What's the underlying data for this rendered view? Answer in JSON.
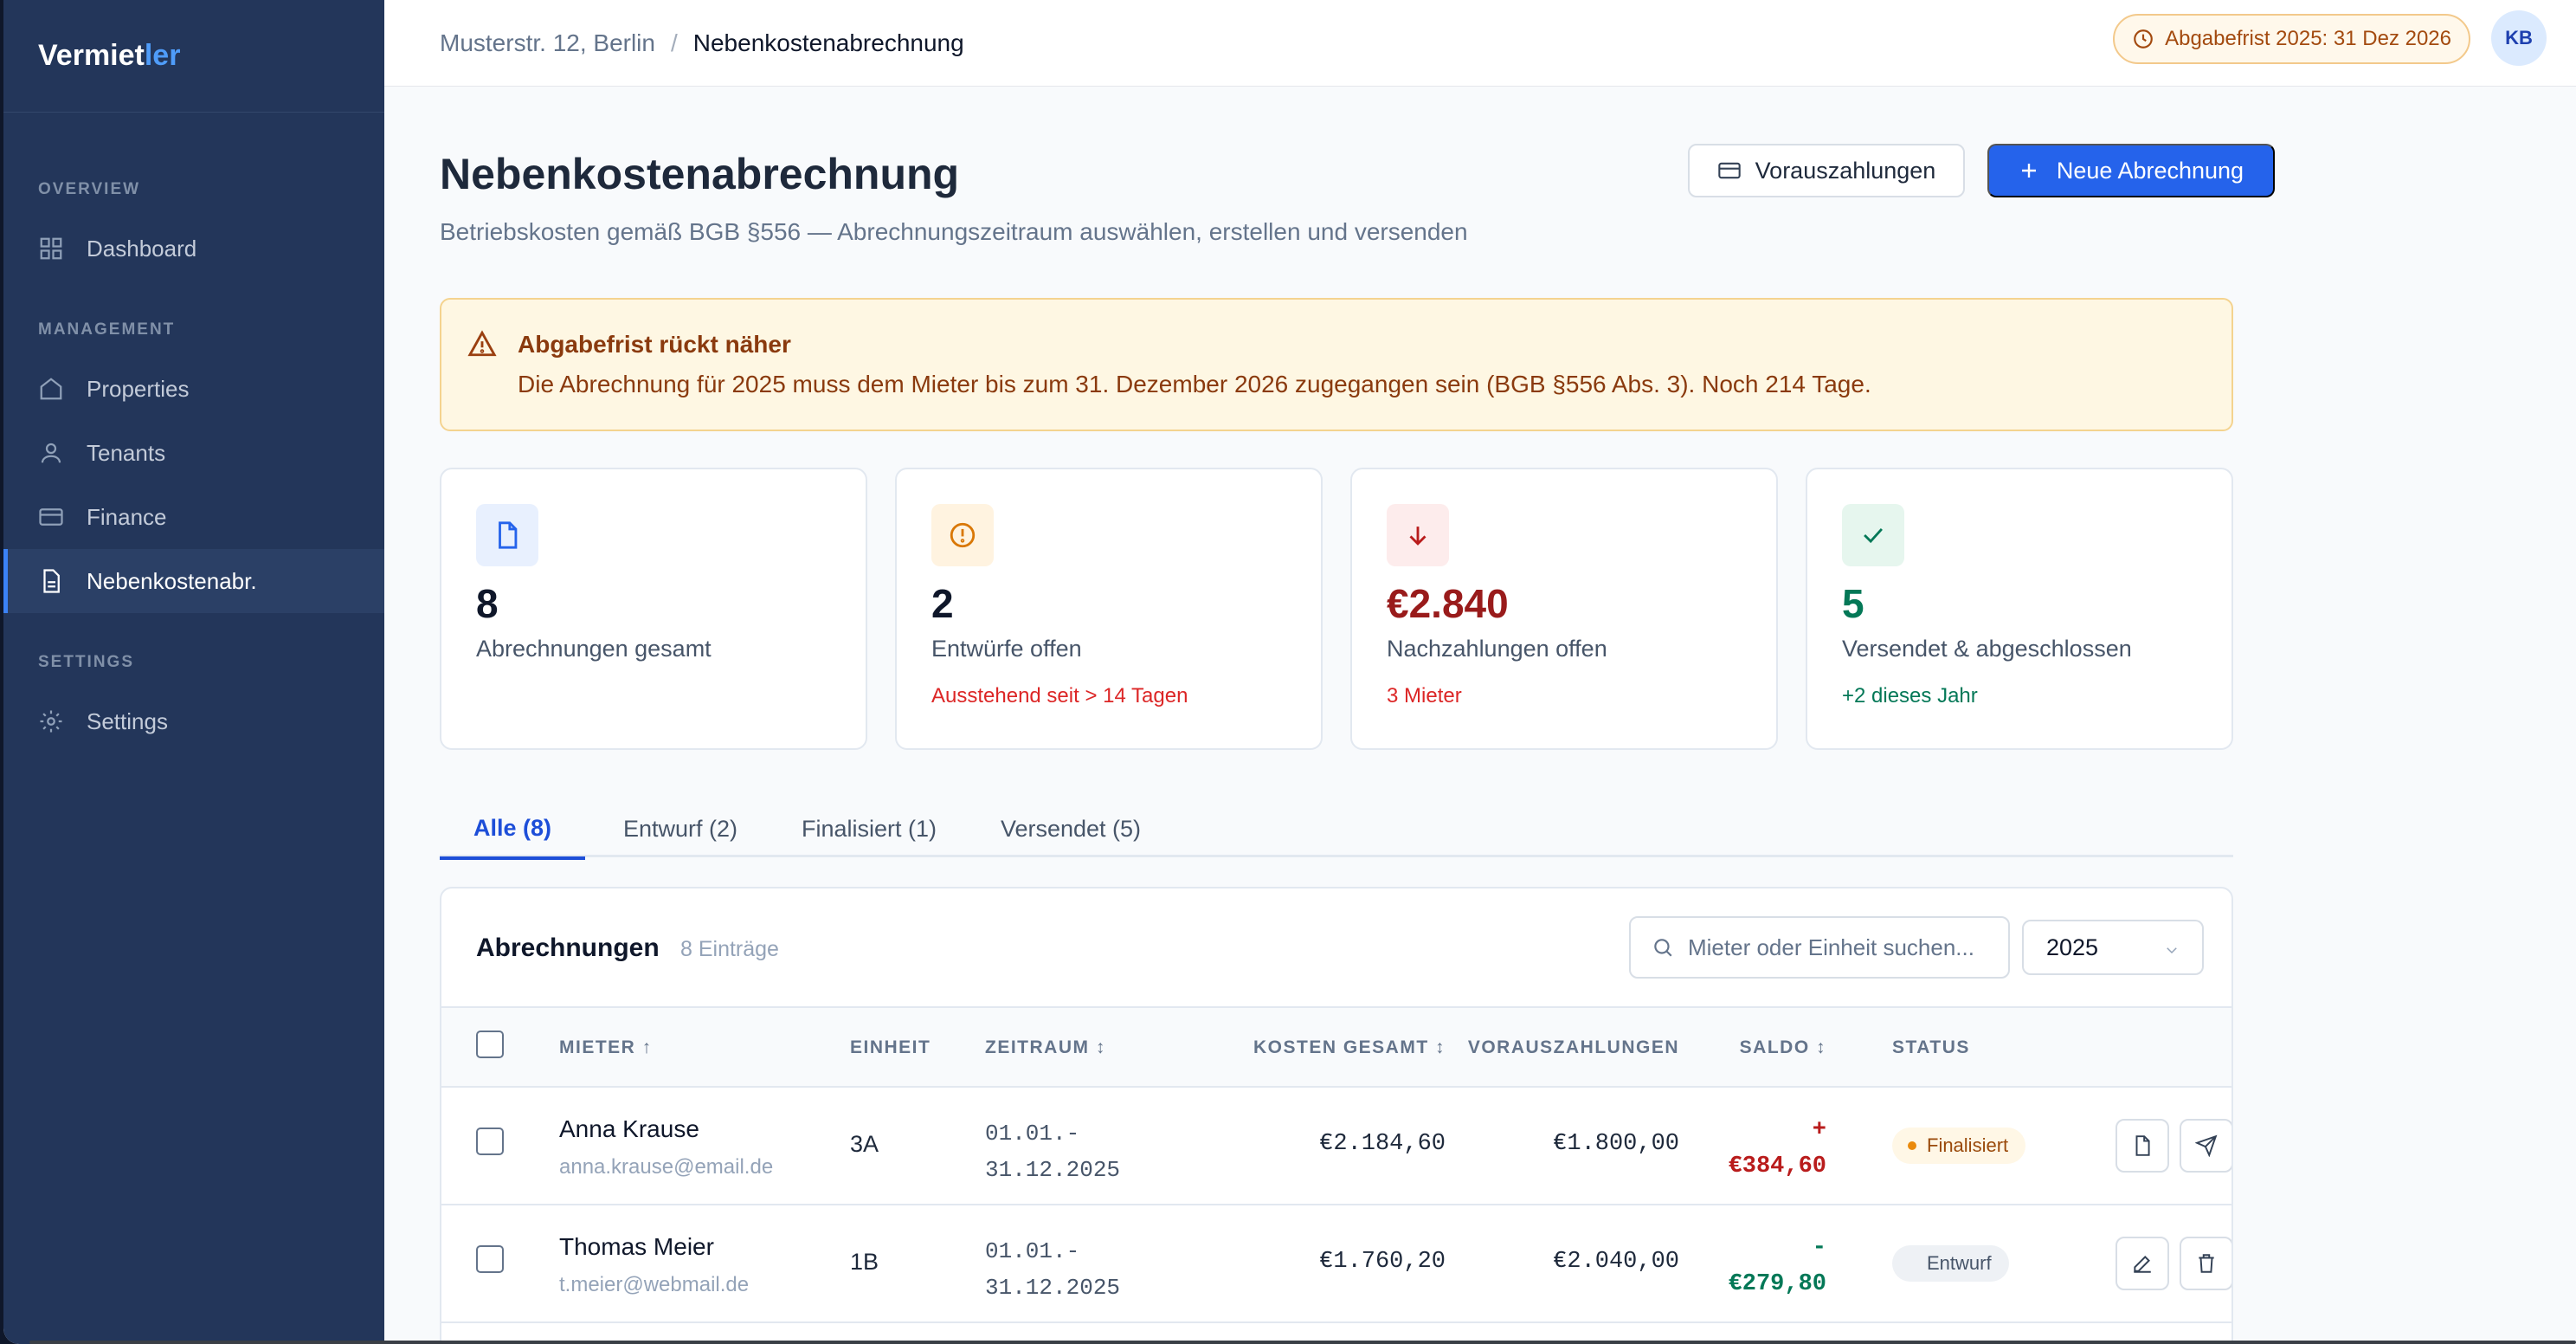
{
  "sidebar": {
    "logo_main": "Vermiet",
    "logo_accent": "ler",
    "sections": {
      "overview": "OVERVIEW",
      "management": "MANAGEMENT",
      "settings": "SETTINGS"
    },
    "items": {
      "dashboard": "Dashboard",
      "properties": "Properties",
      "tenants": "Tenants",
      "finance": "Finance",
      "nebenkosten": "Nebenkostenabr.",
      "settings": "Settings"
    }
  },
  "topbar": {
    "breadcrumb_parent": "Musterstr. 12, Berlin",
    "breadcrumb_sep": "/",
    "breadcrumb_current": "Nebenkostenabrechnung",
    "deadline_pill": "Abgabefrist 2025: 31 Dez 2026",
    "avatar_initials": "KB"
  },
  "header": {
    "title": "Nebenkostenabrechnung",
    "subtitle": "Betriebskosten gemäß BGB §556 — Abrechnungszeitraum auswählen, erstellen und versenden",
    "btn_prepayments": "Vorauszahlungen",
    "btn_new": "Neue Abrechnung"
  },
  "alert": {
    "title": "Abgabefrist rückt näher",
    "text": "Die Abrechnung für 2025 muss dem Mieter bis zum 31. Dezember 2026 zugegangen sein (BGB §556 Abs. 3). Noch 214 Tage."
  },
  "stats": [
    {
      "value": "8",
      "label": "Abrechnungen gesamt",
      "sub": ""
    },
    {
      "value": "2",
      "label": "Entwürfe offen",
      "sub": "Ausstehend seit > 14 Tagen"
    },
    {
      "value": "€2.840",
      "label": "Nachzahlungen offen",
      "sub": "3 Mieter"
    },
    {
      "value": "5",
      "label": "Versendet & abgeschlossen",
      "sub": "+2 dieses Jahr"
    }
  ],
  "tabs": {
    "all": "Alle (8)",
    "draft": "Entwurf (2)",
    "finalized": "Finalisiert (1)",
    "sent": "Versendet (5)"
  },
  "table": {
    "title": "Abrechnungen",
    "count": "8 Einträge",
    "search_placeholder": "Mieter oder Einheit suchen...",
    "year": "2025",
    "headers": {
      "tenant": "MIETER ↑",
      "unit": "EINHEIT",
      "period": "ZEITRAUM ↕",
      "total": "KOSTEN GESAMT ↕",
      "prepay": "VORAUSZAHLUNGEN",
      "saldo": "SALDO ↕",
      "status": "STATUS"
    },
    "rows": [
      {
        "name": "Anna Krause",
        "email": "anna.krause@email.de",
        "unit": "3A",
        "period_start": "01.01.-",
        "period_end": "31.12.2025",
        "total": "€2.184,60",
        "prepay": "€1.800,00",
        "saldo_sign": "+",
        "saldo_value": "€384,60",
        "status": "Finalisiert"
      },
      {
        "name": "Thomas Meier",
        "email": "t.meier@webmail.de",
        "unit": "1B",
        "period_start": "01.01.-",
        "period_end": "31.12.2025",
        "total": "€1.760,20",
        "prepay": "€2.040,00",
        "saldo_sign": "-",
        "saldo_value": "€279,80",
        "status": "Entwurf"
      }
    ]
  },
  "colors": {
    "sidebar": "#23365a",
    "primary": "#2563eb",
    "warning_bg": "#fef7e3",
    "negative": "#b91c1c",
    "positive": "#047857"
  }
}
